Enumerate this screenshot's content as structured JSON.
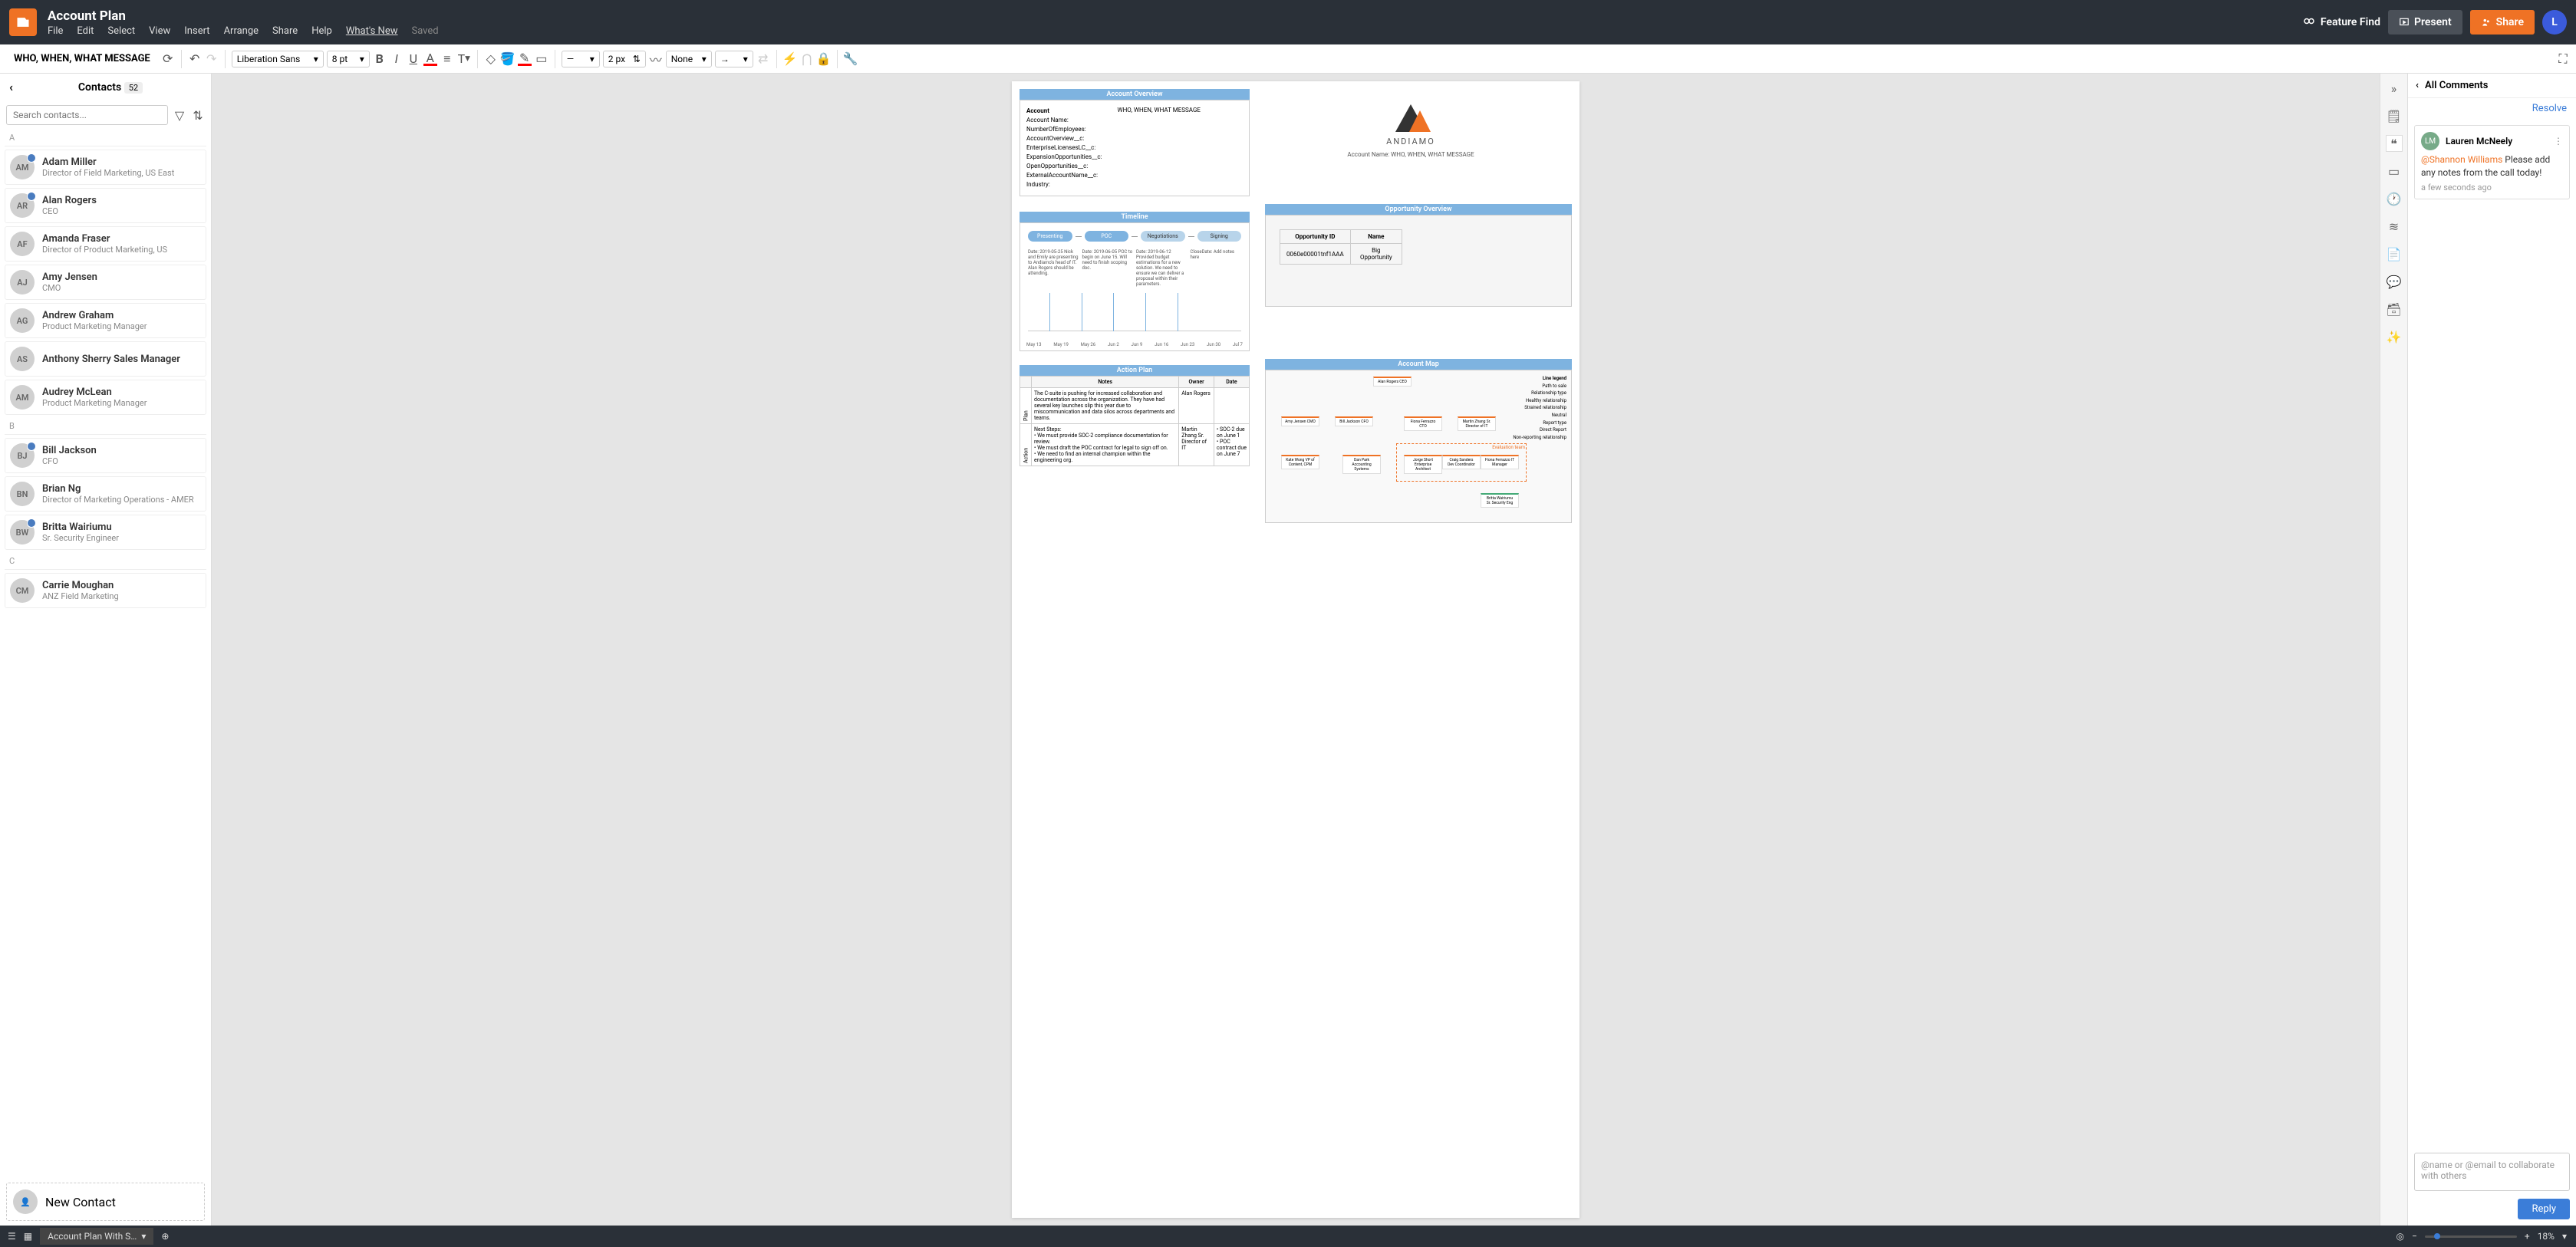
{
  "header": {
    "doc_title": "Account Plan",
    "menus": [
      "File",
      "Edit",
      "Select",
      "View",
      "Insert",
      "Arrange",
      "Share",
      "Help",
      "What's New"
    ],
    "saved": "Saved",
    "feature_find": "Feature Find",
    "present": "Present",
    "share": "Share",
    "user_initial": "L"
  },
  "toolbar": {
    "sheet_name": "WHO, WHEN, WHAT MESSAGE",
    "font": "Liberation Sans",
    "font_size": "8 pt",
    "stroke_width": "2 px",
    "line_type": "None"
  },
  "contacts": {
    "title": "Contacts",
    "count": "52",
    "search_placeholder": "Search contacts...",
    "new_contact": "New Contact",
    "groups": [
      {
        "letter": "A",
        "items": [
          {
            "initials": "AM",
            "name": "Adam Miller",
            "role": "Director of Field Marketing, US East",
            "check": true
          },
          {
            "initials": "AR",
            "name": "Alan Rogers",
            "role": "CEO",
            "check": true
          },
          {
            "initials": "AF",
            "name": "Amanda Fraser",
            "role": "Director of Product Marketing, US"
          },
          {
            "initials": "AJ",
            "name": "Amy Jensen",
            "role": "CMO"
          },
          {
            "initials": "AG",
            "name": "Andrew Graham",
            "role": "Product Marketing Manager"
          },
          {
            "initials": "AS",
            "name": "Anthony Sherry Sales Manager",
            "role": ""
          },
          {
            "initials": "AM",
            "name": "Audrey McLean",
            "role": "Product Marketing Manager"
          }
        ]
      },
      {
        "letter": "B",
        "items": [
          {
            "initials": "BJ",
            "name": "Bill Jackson",
            "role": "CFO",
            "check": true
          },
          {
            "initials": "BN",
            "name": "Brian Ng",
            "role": "Director of Marketing Operations - AMER"
          },
          {
            "initials": "BW",
            "name": "Britta Wairiumu",
            "role": "Sr. Security Engineer",
            "check": true
          }
        ]
      },
      {
        "letter": "C",
        "items": [
          {
            "initials": "CM",
            "name": "Carrie Moughan",
            "role": "ANZ Field Marketing"
          }
        ]
      }
    ]
  },
  "canvas": {
    "account_overview": {
      "title": "Account Overview",
      "fields": [
        "Account",
        "Account Name:",
        "NumberOfEmployees:",
        "AccountOverview__c:",
        "EnterpriseLicensesLC__c:",
        "ExpansionOpportunities__c:",
        "OpenOpportunities__c:",
        "ExternalAccountName__c:",
        "Industry:"
      ],
      "value": "WHO, WHEN, WHAT MESSAGE",
      "company": "ANDIAMO",
      "account_name_label": "Account Name:",
      "account_name_value": "WHO, WHEN, WHAT MESSAGE"
    },
    "timeline": {
      "title": "Timeline",
      "stages": [
        "Presenting",
        "POC",
        "Negotiations",
        "Signing"
      ],
      "notes": [
        "Date: 2019-05-25 Nick and Emily are presenting to Andiamo's head of IT. Alan Rogers should be attending.",
        "Date: 2019-06-05 POC to begin on June 15. Will need to finish scoping doc.",
        "Date: 2019-06-12 Provided budget estimations for a new solution. We need to ensure we can deliver a proposal within their parameters.",
        "CloseDate: Add notes here"
      ],
      "dates": [
        "May 13",
        "May 19",
        "May 26",
        "Jun 2",
        "Jun 9",
        "Jun 16",
        "Jun 23",
        "Jun 30",
        "Jul 7"
      ]
    },
    "opportunity": {
      "title": "Opportunity Overview",
      "cols": [
        "Opportunity ID",
        "Name"
      ],
      "rows": [
        [
          "0060e00001tnf1AAA",
          "Big Opportunity"
        ]
      ]
    },
    "action_plan": {
      "title": "Action Plan",
      "cols": [
        "",
        "Notes",
        "Owner",
        "Date"
      ],
      "plan_label": "Plan",
      "action_label": "Action",
      "plan_notes": "The C-suite is pushing for increased collaboration and documentation across the organization. They have had several key launches slip this year due to miscommunication and data silos across departments and teams.",
      "plan_owner": "Alan Rogers",
      "action_notes": "Next Steps:\n• We must provide SOC-2 compliance documentation for review.\n• We must draft the POC contract for legal to sign off on.\n• We need to find an internal champion within the engineering org.",
      "action_owner": "Martin Zhang Sr. Director of IT",
      "action_dates": "• SOC-2 due on June 1\n• POC contract due on June 7"
    },
    "account_map": {
      "title": "Account Map",
      "legend_title": "Line legend",
      "legend": [
        "Path to sale",
        "Relationship type",
        "Healthy relationship",
        "Strained relationship",
        "Neutral",
        "Report type",
        "Direct Report",
        "Non-reporting relationship"
      ],
      "nodes": [
        "Alan Rogers CEO",
        "Amy Jensen CMO",
        "Bill Jackson CFO",
        "Fiona Ferrazzo CTO",
        "Martin Zhang Sr. Director of IT",
        "Britta Wairiumu Sr. Security Eng",
        "Kate Wong VP of Content, CPM",
        "Dan Park Accounting Systems",
        "Jorge Short Enterprise Architect",
        "Craig Sanders Dev Coordinator",
        "Fiona Ferrazzo IT Manager"
      ],
      "eval_team": "Evaluation team"
    }
  },
  "comments": {
    "header": "All Comments",
    "resolve": "Resolve",
    "thread": {
      "author_initials": "LM",
      "author": "Lauren McNeely",
      "mention": "@Shannon Williams",
      "body": "Please add any notes from the call today!",
      "time": "a few seconds ago"
    },
    "reply_placeholder": "@name or @email to collaborate with others",
    "reply": "Reply"
  },
  "bottombar": {
    "sheet": "Account Plan With S…",
    "zoom": "18%"
  }
}
